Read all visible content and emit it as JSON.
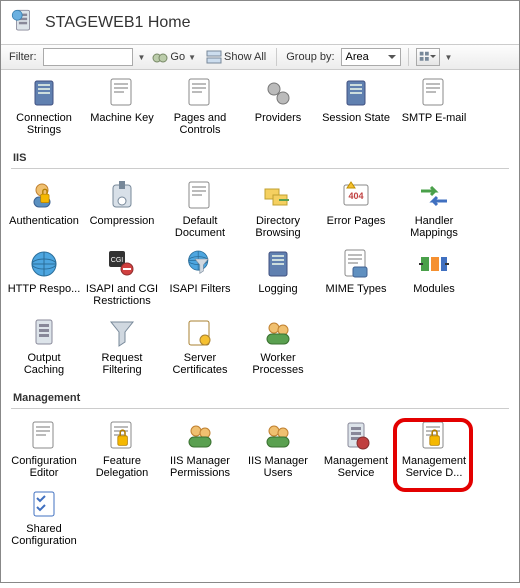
{
  "header": {
    "title": "STAGEWEB1 Home"
  },
  "toolbar": {
    "filter_label": "Filter:",
    "filter_value": "",
    "go_label": "Go",
    "showall_label": "Show All",
    "groupby_label": "Group by:",
    "groupby_value": "Area"
  },
  "rows": {
    "top": [
      {
        "label": "Connection Strings",
        "icon": "connection-strings"
      },
      {
        "label": "Machine Key",
        "icon": "machine-key"
      },
      {
        "label": "Pages and Controls",
        "icon": "pages-controls"
      },
      {
        "label": "Providers",
        "icon": "providers"
      },
      {
        "label": "Session State",
        "icon": "session-state"
      },
      {
        "label": "SMTP E-mail",
        "icon": "smtp-email"
      }
    ]
  },
  "sections": [
    {
      "title": "IIS",
      "items": [
        {
          "label": "Authentication",
          "icon": "authentication"
        },
        {
          "label": "Compression",
          "icon": "compression"
        },
        {
          "label": "Default Document",
          "icon": "default-document"
        },
        {
          "label": "Directory Browsing",
          "icon": "directory-browsing"
        },
        {
          "label": "Error Pages",
          "icon": "error-pages"
        },
        {
          "label": "Handler Mappings",
          "icon": "handler-mappings"
        },
        {
          "label": "HTTP Respo...",
          "icon": "http-response"
        },
        {
          "label": "ISAPI and CGI Restrictions",
          "icon": "isapi-cgi"
        },
        {
          "label": "ISAPI Filters",
          "icon": "isapi-filters"
        },
        {
          "label": "Logging",
          "icon": "logging"
        },
        {
          "label": "MIME Types",
          "icon": "mime-types"
        },
        {
          "label": "Modules",
          "icon": "modules"
        },
        {
          "label": "Output Caching",
          "icon": "output-caching"
        },
        {
          "label": "Request Filtering",
          "icon": "request-filtering"
        },
        {
          "label": "Server Certificates",
          "icon": "server-certificates"
        },
        {
          "label": "Worker Processes",
          "icon": "worker-processes"
        }
      ]
    },
    {
      "title": "Management",
      "items": [
        {
          "label": "Configuration Editor",
          "icon": "config-editor"
        },
        {
          "label": "Feature Delegation",
          "icon": "feature-delegation"
        },
        {
          "label": "IIS Manager Permissions",
          "icon": "iis-mgr-perm"
        },
        {
          "label": "IIS Manager Users",
          "icon": "iis-mgr-users"
        },
        {
          "label": "Management Service",
          "icon": "mgmt-service"
        },
        {
          "label": "Management Service D...",
          "icon": "mgmt-service-del"
        },
        {
          "label": "Shared Configuration",
          "icon": "shared-config"
        }
      ]
    }
  ]
}
